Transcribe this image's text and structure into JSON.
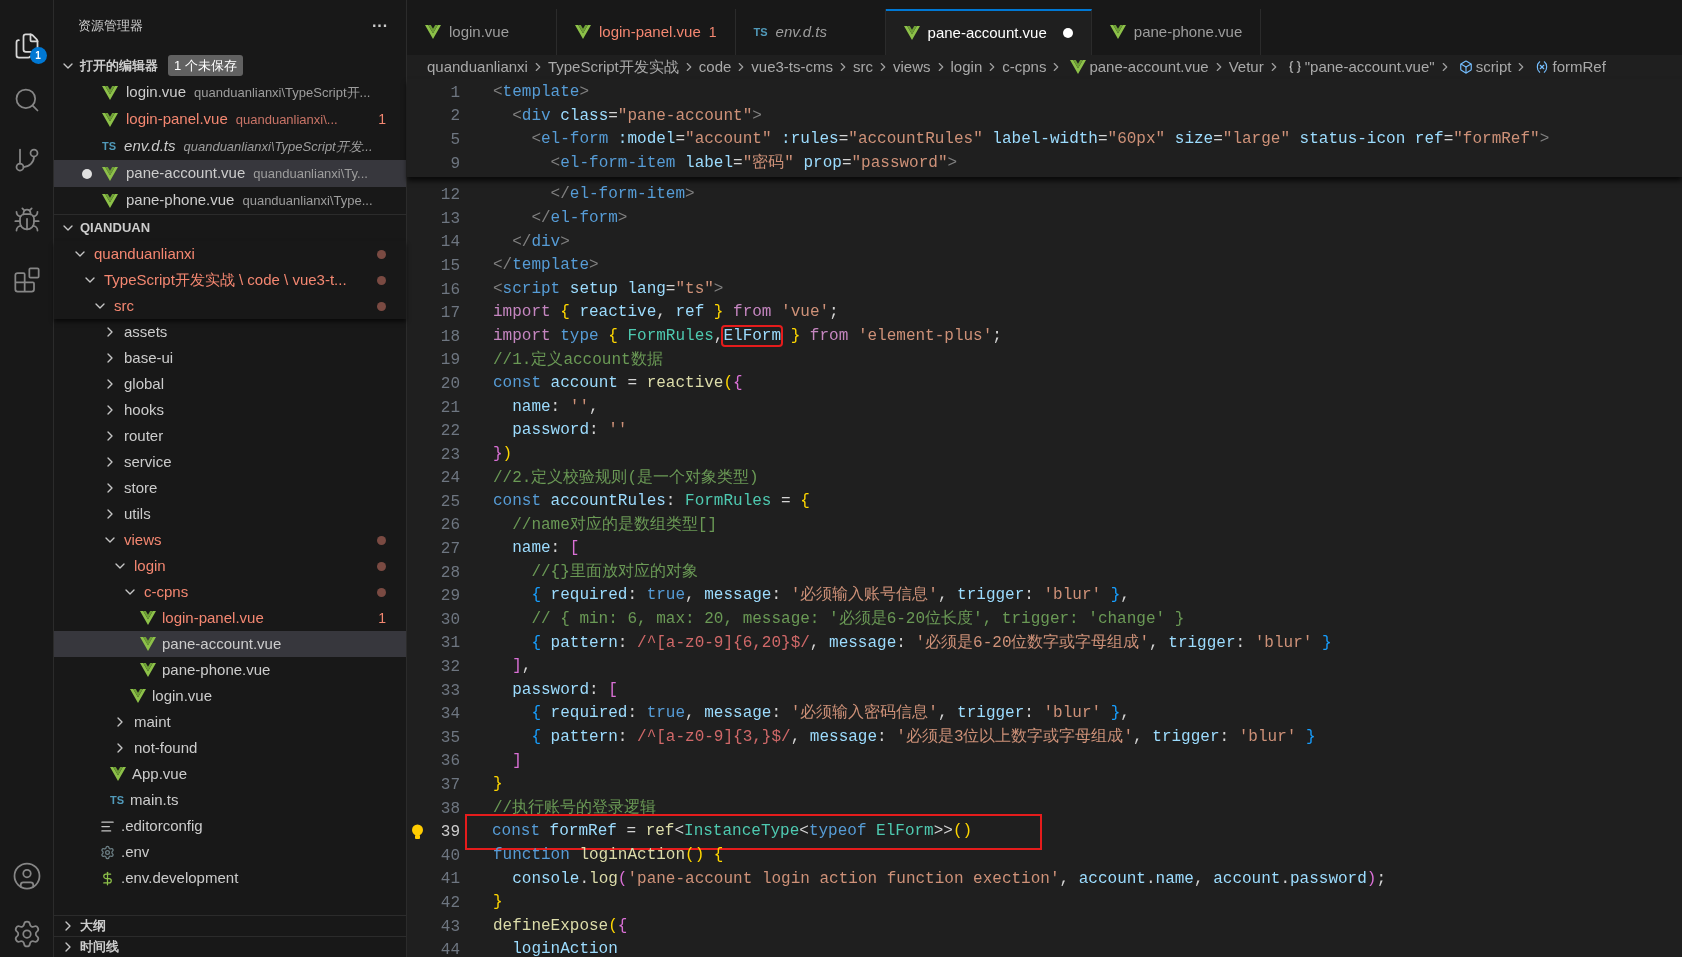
{
  "activity_bar": {
    "explorer_badge": "1"
  },
  "sidebar": {
    "title": "资源管理器",
    "more": "···",
    "open_editors": {
      "title": "打开的编辑器",
      "expanded": true,
      "badge": "1 个未保存",
      "items": [
        {
          "name": "login.vue",
          "description": "quanduanlianxi\\TypeScript开...",
          "kind": "vue",
          "modified": false,
          "italic": false,
          "dirty": false,
          "selected": false
        },
        {
          "name": "login-panel.vue",
          "description": "quanduanlianxi\\...",
          "kind": "vue",
          "modified": true,
          "problems": "1",
          "italic": false,
          "dirty": false,
          "selected": false
        },
        {
          "name": "env.d.ts",
          "description": "quanduanlianxi\\TypeScript开发...",
          "kind": "ts",
          "icon_text": "TS",
          "modified": false,
          "italic": true,
          "dirty": false,
          "selected": false
        },
        {
          "name": "pane-account.vue",
          "description": "quanduanlianxi\\Ty...",
          "kind": "vue",
          "modified": false,
          "italic": false,
          "dirty": true,
          "selected": true
        },
        {
          "name": "pane-phone.vue",
          "description": "quanduanlianxi\\Type...",
          "kind": "vue",
          "modified": false,
          "italic": false,
          "dirty": false,
          "selected": false
        }
      ]
    },
    "workspace": {
      "title": "QIANDUAN",
      "expanded": true,
      "tree": [
        {
          "name": "quanduanlianxi",
          "kind": "folder",
          "expanded": true,
          "modified": true,
          "selected": false,
          "children": [
            {
              "name": "TypeScript开发实战 \\ code \\ vue3-t...",
              "kind": "folder",
              "expanded": true,
              "modified": true,
              "selected": false,
              "children": [
                {
                  "name": "src",
                  "kind": "folder",
                  "expanded": true,
                  "modified": true,
                  "selected": false,
                  "children": [
                    {
                      "name": "assets",
                      "kind": "folder",
                      "expanded": false,
                      "modified": false,
                      "selected": false
                    },
                    {
                      "name": "base-ui",
                      "kind": "folder",
                      "expanded": false,
                      "modified": false,
                      "selected": false
                    },
                    {
                      "name": "global",
                      "kind": "folder",
                      "expanded": false,
                      "modified": false,
                      "selected": false
                    },
                    {
                      "name": "hooks",
                      "kind": "folder",
                      "expanded": false,
                      "modified": false,
                      "selected": false
                    },
                    {
                      "name": "router",
                      "kind": "folder",
                      "expanded": false,
                      "modified": false,
                      "selected": false
                    },
                    {
                      "name": "service",
                      "kind": "folder",
                      "expanded": false,
                      "modified": false,
                      "selected": false
                    },
                    {
                      "name": "store",
                      "kind": "folder",
                      "expanded": false,
                      "modified": false,
                      "selected": false
                    },
                    {
                      "name": "utils",
                      "kind": "folder",
                      "expanded": false,
                      "modified": false,
                      "selected": false
                    },
                    {
                      "name": "views",
                      "kind": "folder",
                      "expanded": true,
                      "modified": true,
                      "selected": false,
                      "children": [
                        {
                          "name": "login",
                          "kind": "folder",
                          "expanded": true,
                          "modified": true,
                          "selected": false,
                          "children": [
                            {
                              "name": "c-cpns",
                              "kind": "folder",
                              "expanded": true,
                              "modified": true,
                              "selected": false,
                              "children": [
                                {
                                  "name": "login-panel.vue",
                                  "kind": "vue",
                                  "modified": true,
                                  "problems": "1",
                                  "selected": false
                                },
                                {
                                  "name": "pane-account.vue",
                                  "kind": "vue",
                                  "modified": false,
                                  "selected": true
                                },
                                {
                                  "name": "pane-phone.vue",
                                  "kind": "vue",
                                  "modified": false,
                                  "selected": false
                                }
                              ]
                            },
                            {
                              "name": "login.vue",
                              "kind": "vue",
                              "modified": false,
                              "selected": false
                            }
                          ]
                        },
                        {
                          "name": "maint",
                          "kind": "folder",
                          "expanded": false,
                          "modified": false,
                          "selected": false
                        },
                        {
                          "name": "not-found",
                          "kind": "folder",
                          "expanded": false,
                          "modified": false,
                          "selected": false
                        }
                      ]
                    },
                    {
                      "name": "App.vue",
                      "kind": "vue",
                      "modified": false,
                      "selected": false
                    },
                    {
                      "name": "main.ts",
                      "kind": "ts",
                      "icon_text": "TS",
                      "modified": false,
                      "selected": false
                    }
                  ]
                },
                {
                  "name": ".editorconfig",
                  "kind": "config",
                  "modified": false,
                  "selected": false
                },
                {
                  "name": ".env",
                  "kind": "gear",
                  "modified": false,
                  "selected": false
                },
                {
                  "name": ".env.development",
                  "kind": "dollar",
                  "modified": false,
                  "selected": false
                }
              ]
            }
          ]
        }
      ]
    },
    "panels": [
      {
        "title": "大纲",
        "expanded": false
      },
      {
        "title": "时间线",
        "expanded": false
      }
    ]
  },
  "tabs": [
    {
      "label": "login.vue",
      "kind": "vue",
      "selected": false,
      "modified": false,
      "italic": false,
      "dirty": false
    },
    {
      "label": "login-panel.vue",
      "kind": "vue",
      "selected": false,
      "modified": true,
      "problems": "1",
      "italic": false,
      "dirty": false
    },
    {
      "label": "env.d.ts",
      "kind": "ts",
      "icon_text": "TS",
      "selected": false,
      "modified": false,
      "italic": true,
      "dirty": false
    },
    {
      "label": "pane-account.vue",
      "kind": "vue",
      "selected": true,
      "modified": false,
      "italic": false,
      "dirty": true
    },
    {
      "label": "pane-phone.vue",
      "kind": "vue",
      "selected": false,
      "modified": false,
      "italic": false,
      "dirty": false
    }
  ],
  "breadcrumbs": [
    {
      "text": "quanduanlianxi",
      "kind": "folder"
    },
    {
      "text": "TypeScript开发实战",
      "kind": "folder"
    },
    {
      "text": "code",
      "kind": "folder"
    },
    {
      "text": "vue3-ts-cms",
      "kind": "folder"
    },
    {
      "text": "src",
      "kind": "folder"
    },
    {
      "text": "views",
      "kind": "folder"
    },
    {
      "text": "login",
      "kind": "folder"
    },
    {
      "text": "c-cpns",
      "kind": "folder"
    },
    {
      "text": "pane-account.vue",
      "kind": "vue"
    },
    {
      "text": "Vetur",
      "kind": "folder"
    },
    {
      "text": "\"pane-account.vue\"",
      "kind": "braces"
    },
    {
      "text": "script",
      "kind": "cube"
    },
    {
      "text": "formRef",
      "kind": "field"
    }
  ],
  "sticky_lines": [
    {
      "n": "1",
      "tokens": [
        {
          "kind": "g",
          "text": "<"
        },
        {
          "kind": "tag",
          "text": "template"
        },
        {
          "kind": "g",
          "text": ">"
        }
      ]
    },
    {
      "n": "2",
      "tokens": [
        {
          "kind": "g",
          "text": "  <"
        },
        {
          "kind": "tag",
          "text": "div"
        },
        {
          "kind": "attr",
          "text": " class"
        },
        {
          "kind": "p",
          "text": "="
        },
        {
          "kind": "str",
          "text": "\"pane-account\""
        },
        {
          "kind": "g",
          "text": ">"
        }
      ]
    },
    {
      "n": "5",
      "tokens": [
        {
          "kind": "g",
          "text": "    <"
        },
        {
          "kind": "tag",
          "text": "el-form"
        },
        {
          "kind": "attr",
          "text": " :model"
        },
        {
          "kind": "p",
          "text": "="
        },
        {
          "kind": "str",
          "text": "\"account\""
        },
        {
          "kind": "attr",
          "text": " :rules"
        },
        {
          "kind": "p",
          "text": "="
        },
        {
          "kind": "str",
          "text": "\"accountRules\""
        },
        {
          "kind": "attr",
          "text": " label-width"
        },
        {
          "kind": "p",
          "text": "="
        },
        {
          "kind": "str",
          "text": "\"60px\""
        },
        {
          "kind": "attr",
          "text": " size"
        },
        {
          "kind": "p",
          "text": "="
        },
        {
          "kind": "str",
          "text": "\"large\""
        },
        {
          "kind": "attr",
          "text": " status-icon ref"
        },
        {
          "kind": "p",
          "text": "="
        },
        {
          "kind": "str",
          "text": "\"formRef\""
        },
        {
          "kind": "g",
          "text": ">"
        }
      ]
    },
    {
      "n": "9",
      "tokens": [
        {
          "kind": "g",
          "text": "      <"
        },
        {
          "kind": "tag",
          "text": "el-form-item"
        },
        {
          "kind": "attr",
          "text": " label"
        },
        {
          "kind": "p",
          "text": "="
        },
        {
          "kind": "str",
          "text": "\"密码\""
        },
        {
          "kind": "attr",
          "text": " prop"
        },
        {
          "kind": "p",
          "text": "="
        },
        {
          "kind": "str",
          "text": "\"password\""
        },
        {
          "kind": "g",
          "text": ">"
        }
      ]
    }
  ],
  "lines": [
    {
      "n": "12",
      "tokens": [
        {
          "kind": "g",
          "text": "      </"
        },
        {
          "kind": "tag",
          "text": "el-form-item"
        },
        {
          "kind": "g",
          "text": ">"
        }
      ]
    },
    {
      "n": "13",
      "tokens": [
        {
          "kind": "g",
          "text": "    </"
        },
        {
          "kind": "tag",
          "text": "el-form"
        },
        {
          "kind": "g",
          "text": ">"
        }
      ]
    },
    {
      "n": "14",
      "tokens": [
        {
          "kind": "g",
          "text": "  </"
        },
        {
          "kind": "tag",
          "text": "div"
        },
        {
          "kind": "g",
          "text": ">"
        }
      ]
    },
    {
      "n": "15",
      "tokens": [
        {
          "kind": "g",
          "text": "</"
        },
        {
          "kind": "tag",
          "text": "template"
        },
        {
          "kind": "g",
          "text": ">"
        }
      ]
    },
    {
      "n": "16",
      "tokens": [
        {
          "kind": "g",
          "text": "<"
        },
        {
          "kind": "tag",
          "text": "script"
        },
        {
          "kind": "attr",
          "text": " setup lang"
        },
        {
          "kind": "p",
          "text": "="
        },
        {
          "kind": "str",
          "text": "\"ts\""
        },
        {
          "kind": "g",
          "text": ">"
        }
      ]
    },
    {
      "n": "17",
      "tokens": [
        {
          "kind": "ctl",
          "text": "import"
        },
        {
          "kind": "b1",
          "text": " {"
        },
        {
          "kind": "var",
          "text": " reactive"
        },
        {
          "kind": "p",
          "text": ", "
        },
        {
          "kind": "var",
          "text": "ref"
        },
        {
          "kind": "b1",
          "text": " }"
        },
        {
          "kind": "ctl",
          "text": " from"
        },
        {
          "kind": "str",
          "text": " 'vue'"
        },
        {
          "kind": "p",
          "text": ";"
        }
      ]
    },
    {
      "n": "18",
      "tokens": [
        {
          "kind": "ctl",
          "text": "import"
        },
        {
          "kind": "kw",
          "text": " type"
        },
        {
          "kind": "b1",
          "text": " {"
        },
        {
          "kind": "type",
          "text": " FormRules"
        },
        {
          "kind": "p",
          "text": ","
        },
        {
          "kind": "var",
          "text": "ElForm",
          "boxed": true
        },
        {
          "kind": "b1",
          "text": " }"
        },
        {
          "kind": "ctl",
          "text": " from"
        },
        {
          "kind": "str",
          "text": " 'element-plus'"
        },
        {
          "kind": "p",
          "text": ";"
        }
      ]
    },
    {
      "n": "19",
      "tokens": [
        {
          "kind": "com",
          "text": "//1.定义account数据"
        }
      ]
    },
    {
      "n": "20",
      "tokens": [
        {
          "kind": "kw",
          "text": "const"
        },
        {
          "kind": "var",
          "text": " account"
        },
        {
          "kind": "p",
          "text": " = "
        },
        {
          "kind": "fn",
          "text": "reactive"
        },
        {
          "kind": "b1",
          "text": "("
        },
        {
          "kind": "b2",
          "text": "{"
        }
      ]
    },
    {
      "n": "21",
      "tokens": [
        {
          "kind": "var",
          "text": "  name"
        },
        {
          "kind": "p",
          "text": ": "
        },
        {
          "kind": "str",
          "text": "''"
        },
        {
          "kind": "p",
          "text": ","
        }
      ]
    },
    {
      "n": "22",
      "tokens": [
        {
          "kind": "var",
          "text": "  password"
        },
        {
          "kind": "p",
          "text": ": "
        },
        {
          "kind": "str",
          "text": "''"
        }
      ]
    },
    {
      "n": "23",
      "tokens": [
        {
          "kind": "b2",
          "text": "}"
        },
        {
          "kind": "b1",
          "text": ")"
        }
      ]
    },
    {
      "n": "24",
      "tokens": [
        {
          "kind": "com",
          "text": "//2.定义校验规则(是一个对象类型)"
        }
      ]
    },
    {
      "n": "25",
      "tokens": [
        {
          "kind": "kw",
          "text": "const"
        },
        {
          "kind": "var",
          "text": " accountRules"
        },
        {
          "kind": "p",
          "text": ": "
        },
        {
          "kind": "type",
          "text": "FormRules"
        },
        {
          "kind": "p",
          "text": " = "
        },
        {
          "kind": "b1",
          "text": "{"
        }
      ]
    },
    {
      "n": "26",
      "tokens": [
        {
          "kind": "com",
          "text": "  //name对应的是数组类型[]"
        }
      ]
    },
    {
      "n": "27",
      "tokens": [
        {
          "kind": "var",
          "text": "  name"
        },
        {
          "kind": "p",
          "text": ": "
        },
        {
          "kind": "b2",
          "text": "["
        }
      ]
    },
    {
      "n": "28",
      "tokens": [
        {
          "kind": "com",
          "text": "    //{}里面放对应的对象"
        }
      ]
    },
    {
      "n": "29",
      "tokens": [
        {
          "kind": "b3",
          "text": "    {"
        },
        {
          "kind": "var",
          "text": " required"
        },
        {
          "kind": "p",
          "text": ": "
        },
        {
          "kind": "kw",
          "text": "true"
        },
        {
          "kind": "p",
          "text": ", "
        },
        {
          "kind": "var",
          "text": "message"
        },
        {
          "kind": "p",
          "text": ": "
        },
        {
          "kind": "str",
          "text": "'必须输入账号信息'"
        },
        {
          "kind": "p",
          "text": ", "
        },
        {
          "kind": "var",
          "text": "trigger"
        },
        {
          "kind": "p",
          "text": ": "
        },
        {
          "kind": "str",
          "text": "'blur'"
        },
        {
          "kind": "b3",
          "text": " }"
        },
        {
          "kind": "p",
          "text": ","
        }
      ]
    },
    {
      "n": "30",
      "tokens": [
        {
          "kind": "com",
          "text": "    // { min: 6, max: 20, message: '必须是6-20位长度', trigger: 'change' }"
        }
      ]
    },
    {
      "n": "31",
      "tokens": [
        {
          "kind": "b3",
          "text": "    {"
        },
        {
          "kind": "var",
          "text": " pattern"
        },
        {
          "kind": "p",
          "text": ": "
        },
        {
          "kind": "rx",
          "text": "/^[a-z0-9]{6,20}$/"
        },
        {
          "kind": "p",
          "text": ", "
        },
        {
          "kind": "var",
          "text": "message"
        },
        {
          "kind": "p",
          "text": ": "
        },
        {
          "kind": "str",
          "text": "'必须是6-20位数字或字母组成'"
        },
        {
          "kind": "p",
          "text": ", "
        },
        {
          "kind": "var",
          "text": "trigger"
        },
        {
          "kind": "p",
          "text": ": "
        },
        {
          "kind": "str",
          "text": "'blur'"
        },
        {
          "kind": "b3",
          "text": " }"
        }
      ]
    },
    {
      "n": "32",
      "tokens": [
        {
          "kind": "b2",
          "text": "  ]"
        },
        {
          "kind": "p",
          "text": ","
        }
      ]
    },
    {
      "n": "33",
      "tokens": [
        {
          "kind": "var",
          "text": "  password"
        },
        {
          "kind": "p",
          "text": ": "
        },
        {
          "kind": "b2",
          "text": "["
        }
      ]
    },
    {
      "n": "34",
      "tokens": [
        {
          "kind": "b3",
          "text": "    {"
        },
        {
          "kind": "var",
          "text": " required"
        },
        {
          "kind": "p",
          "text": ": "
        },
        {
          "kind": "kw",
          "text": "true"
        },
        {
          "kind": "p",
          "text": ", "
        },
        {
          "kind": "var",
          "text": "message"
        },
        {
          "kind": "p",
          "text": ": "
        },
        {
          "kind": "str",
          "text": "'必须输入密码信息'"
        },
        {
          "kind": "p",
          "text": ", "
        },
        {
          "kind": "var",
          "text": "trigger"
        },
        {
          "kind": "p",
          "text": ": "
        },
        {
          "kind": "str",
          "text": "'blur'"
        },
        {
          "kind": "b3",
          "text": " }"
        },
        {
          "kind": "p",
          "text": ","
        }
      ]
    },
    {
      "n": "35",
      "tokens": [
        {
          "kind": "b3",
          "text": "    {"
        },
        {
          "kind": "var",
          "text": " pattern"
        },
        {
          "kind": "p",
          "text": ": "
        },
        {
          "kind": "rx",
          "text": "/^[a-z0-9]{3,}$/"
        },
        {
          "kind": "p",
          "text": ", "
        },
        {
          "kind": "var",
          "text": "message"
        },
        {
          "kind": "p",
          "text": ": "
        },
        {
          "kind": "str",
          "text": "'必须是3位以上数字或字母组成'"
        },
        {
          "kind": "p",
          "text": ", "
        },
        {
          "kind": "var",
          "text": "trigger"
        },
        {
          "kind": "p",
          "text": ": "
        },
        {
          "kind": "str",
          "text": "'blur'"
        },
        {
          "kind": "b3",
          "text": " }"
        }
      ]
    },
    {
      "n": "36",
      "tokens": [
        {
          "kind": "b2",
          "text": "  ]"
        }
      ]
    },
    {
      "n": "37",
      "tokens": [
        {
          "kind": "b1",
          "text": "}"
        }
      ]
    },
    {
      "n": "38",
      "tokens": [
        {
          "kind": "com",
          "text": "//执行账号的登录逻辑"
        }
      ]
    },
    {
      "n": "39",
      "boxed": true,
      "lightbulb": true,
      "tokens": [
        {
          "kind": "kw",
          "text": "const"
        },
        {
          "kind": "var",
          "text": " formRef"
        },
        {
          "kind": "p",
          "text": " = "
        },
        {
          "kind": "fn",
          "text": "ref"
        },
        {
          "kind": "p",
          "text": "<"
        },
        {
          "kind": "type",
          "text": "InstanceType"
        },
        {
          "kind": "p",
          "text": "<"
        },
        {
          "kind": "kw",
          "text": "typeof"
        },
        {
          "kind": "type",
          "text": " ElForm"
        },
        {
          "kind": "p",
          "text": ">>"
        },
        {
          "kind": "b1",
          "text": "()"
        }
      ]
    },
    {
      "n": "40",
      "tokens": [
        {
          "kind": "kw",
          "text": "function"
        },
        {
          "kind": "fn",
          "text": " loginAction"
        },
        {
          "kind": "b1",
          "text": "()"
        },
        {
          "kind": "b1",
          "text": " {"
        }
      ]
    },
    {
      "n": "41",
      "tokens": [
        {
          "kind": "var",
          "text": "  console"
        },
        {
          "kind": "p",
          "text": "."
        },
        {
          "kind": "fn",
          "text": "log"
        },
        {
          "kind": "b2",
          "text": "("
        },
        {
          "kind": "str",
          "text": "'pane-account login action function exection'"
        },
        {
          "kind": "p",
          "text": ", "
        },
        {
          "kind": "var",
          "text": "account"
        },
        {
          "kind": "p",
          "text": "."
        },
        {
          "kind": "var",
          "text": "name"
        },
        {
          "kind": "p",
          "text": ", "
        },
        {
          "kind": "var",
          "text": "account"
        },
        {
          "kind": "p",
          "text": "."
        },
        {
          "kind": "var",
          "text": "password"
        },
        {
          "kind": "b2",
          "text": ")"
        },
        {
          "kind": "p",
          "text": ";"
        }
      ]
    },
    {
      "n": "42",
      "tokens": [
        {
          "kind": "b1",
          "text": "}"
        }
      ]
    },
    {
      "n": "43",
      "tokens": [
        {
          "kind": "fn",
          "text": "defineExpose"
        },
        {
          "kind": "b1",
          "text": "("
        },
        {
          "kind": "b2",
          "text": "{"
        }
      ]
    },
    {
      "n": "44",
      "tokens": [
        {
          "kind": "var",
          "text": "  loginAction"
        }
      ]
    }
  ]
}
